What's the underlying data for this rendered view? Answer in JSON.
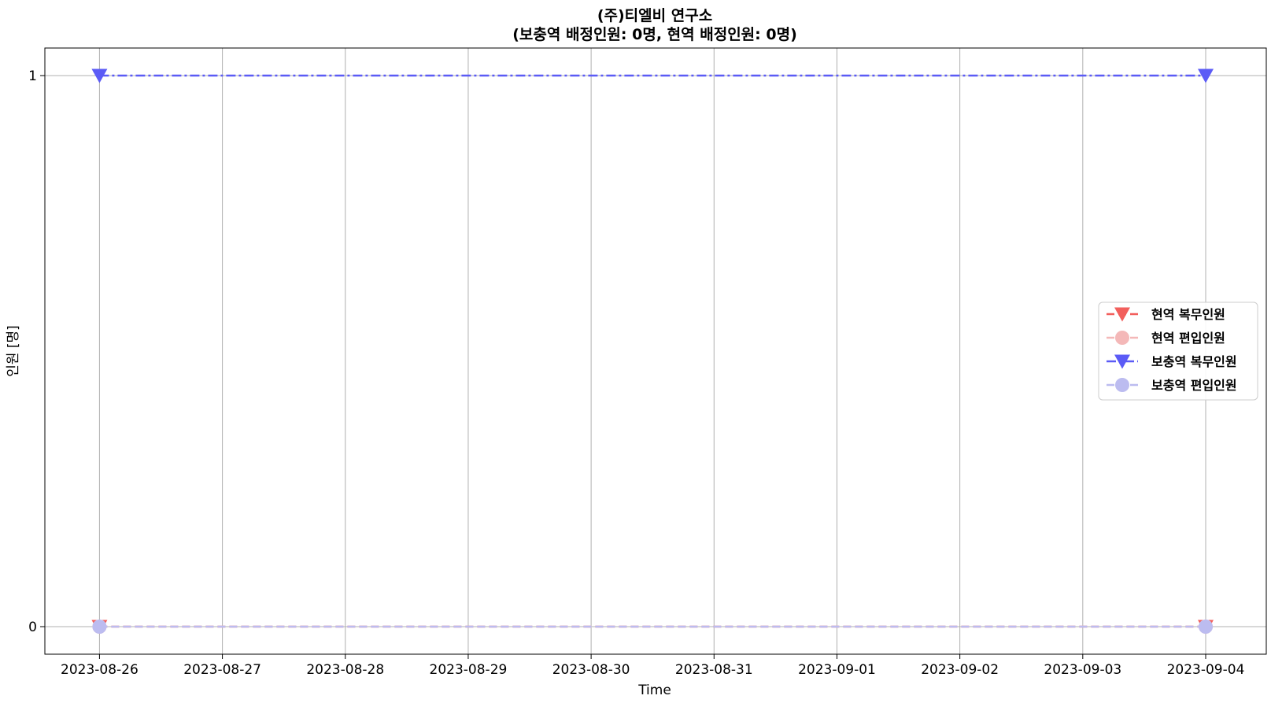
{
  "chart_data": {
    "type": "line",
    "title": "(주)티엘비   연구소",
    "subtitle": "(보충역   배정인원:   0명,   현역   배정인원:   0명)",
    "xlabel": "Time",
    "ylabel": "인원   [명]",
    "x": [
      "2023-08-26",
      "2023-09-04"
    ],
    "x_ticks": [
      "2023-08-26",
      "2023-08-27",
      "2023-08-28",
      "2023-08-29",
      "2023-08-30",
      "2023-08-31",
      "2023-09-01",
      "2023-09-02",
      "2023-09-03",
      "2023-09-04"
    ],
    "y_ticks": [
      "0",
      "1"
    ],
    "xlim": [
      "2023-08-25T13:20",
      "2023-09-04T11:50"
    ],
    "ylim": [
      -0.05,
      1.05
    ],
    "grid": true,
    "legend_position": "center-right",
    "series": [
      {
        "name": "현역   복무인원",
        "values": [
          0,
          0
        ],
        "color": "#f25f5c",
        "marker": "triangle-down",
        "linestyle": "dashed"
      },
      {
        "name": "현역   편입인원",
        "values": [
          0,
          0
        ],
        "color": "#f4b8b8",
        "marker": "circle",
        "linestyle": "dashed"
      },
      {
        "name": "보충역   복무인원",
        "values": [
          1,
          1
        ],
        "color": "#5b5bf6",
        "marker": "triangle-down",
        "linestyle": "dashdot"
      },
      {
        "name": "보충역   편입인원",
        "values": [
          0,
          0
        ],
        "color": "#bcbcf0",
        "marker": "circle",
        "linestyle": "dashed"
      }
    ]
  }
}
